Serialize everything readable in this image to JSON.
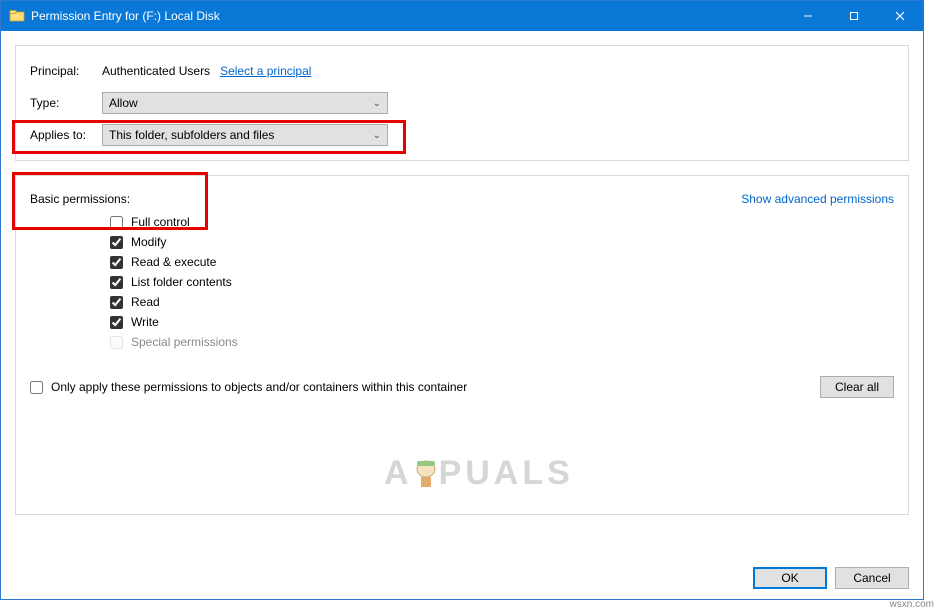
{
  "window": {
    "title": "Permission Entry for (F:) Local Disk"
  },
  "principal": {
    "label": "Principal:",
    "name": "Authenticated Users",
    "select_link": "Select a principal"
  },
  "type": {
    "label": "Type:",
    "value": "Allow"
  },
  "applies": {
    "label": "Applies to:",
    "value": "This folder, subfolders and files"
  },
  "permissions": {
    "heading": "Basic permissions:",
    "advanced_link": "Show advanced permissions",
    "items": [
      {
        "label": "Full control",
        "checked": false,
        "disabled": false
      },
      {
        "label": "Modify",
        "checked": true,
        "disabled": false
      },
      {
        "label": "Read & execute",
        "checked": true,
        "disabled": false
      },
      {
        "label": "List folder contents",
        "checked": true,
        "disabled": false
      },
      {
        "label": "Read",
        "checked": true,
        "disabled": false
      },
      {
        "label": "Write",
        "checked": true,
        "disabled": false
      },
      {
        "label": "Special permissions",
        "checked": false,
        "disabled": true
      }
    ],
    "only_apply": {
      "label": "Only apply these permissions to objects and/or containers within this container",
      "checked": false
    },
    "clear_all": "Clear all"
  },
  "buttons": {
    "ok": "OK",
    "cancel": "Cancel"
  },
  "watermark": {
    "prefix": "A",
    "suffix": "PUALS"
  },
  "attribution": "wsxn.com"
}
